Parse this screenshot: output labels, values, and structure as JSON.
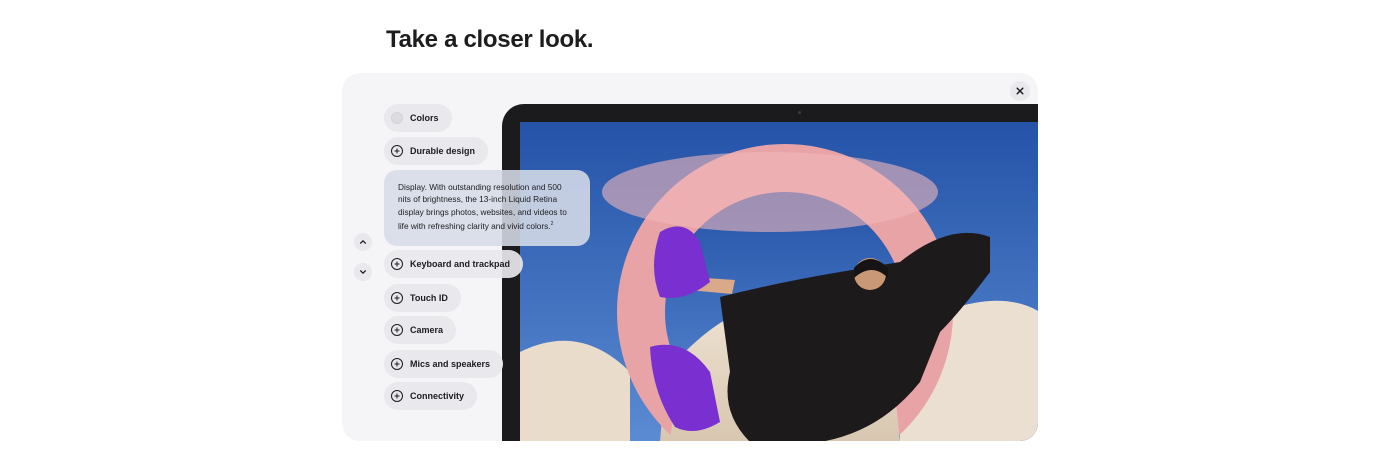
{
  "page": {
    "title": "Take a closer look."
  },
  "controls": {
    "close_icon": "close-icon",
    "up_icon": "chevron-up-icon",
    "down_icon": "chevron-down-icon"
  },
  "features": {
    "colors": "Colors",
    "durable": "Durable design",
    "display_text": "Display. With outstanding resolution and 500 nits of brightness, the 13-inch Liquid Retina display brings photos, websites, and videos to life with refreshing clarity and vivid colors.",
    "display_footnote": "2",
    "keyboard": "Keyboard and trackpad",
    "touch": "Touch ID",
    "camera": "Camera",
    "mics": "Mics and speakers",
    "connectivity": "Connectivity"
  },
  "colors": {
    "background": "#f5f5f7",
    "pill": "#e8e8ed",
    "text": "#1d1d1f",
    "sky": "#2f62b8",
    "ring": "#e8a3a6",
    "shoe": "#7a2fd1"
  }
}
